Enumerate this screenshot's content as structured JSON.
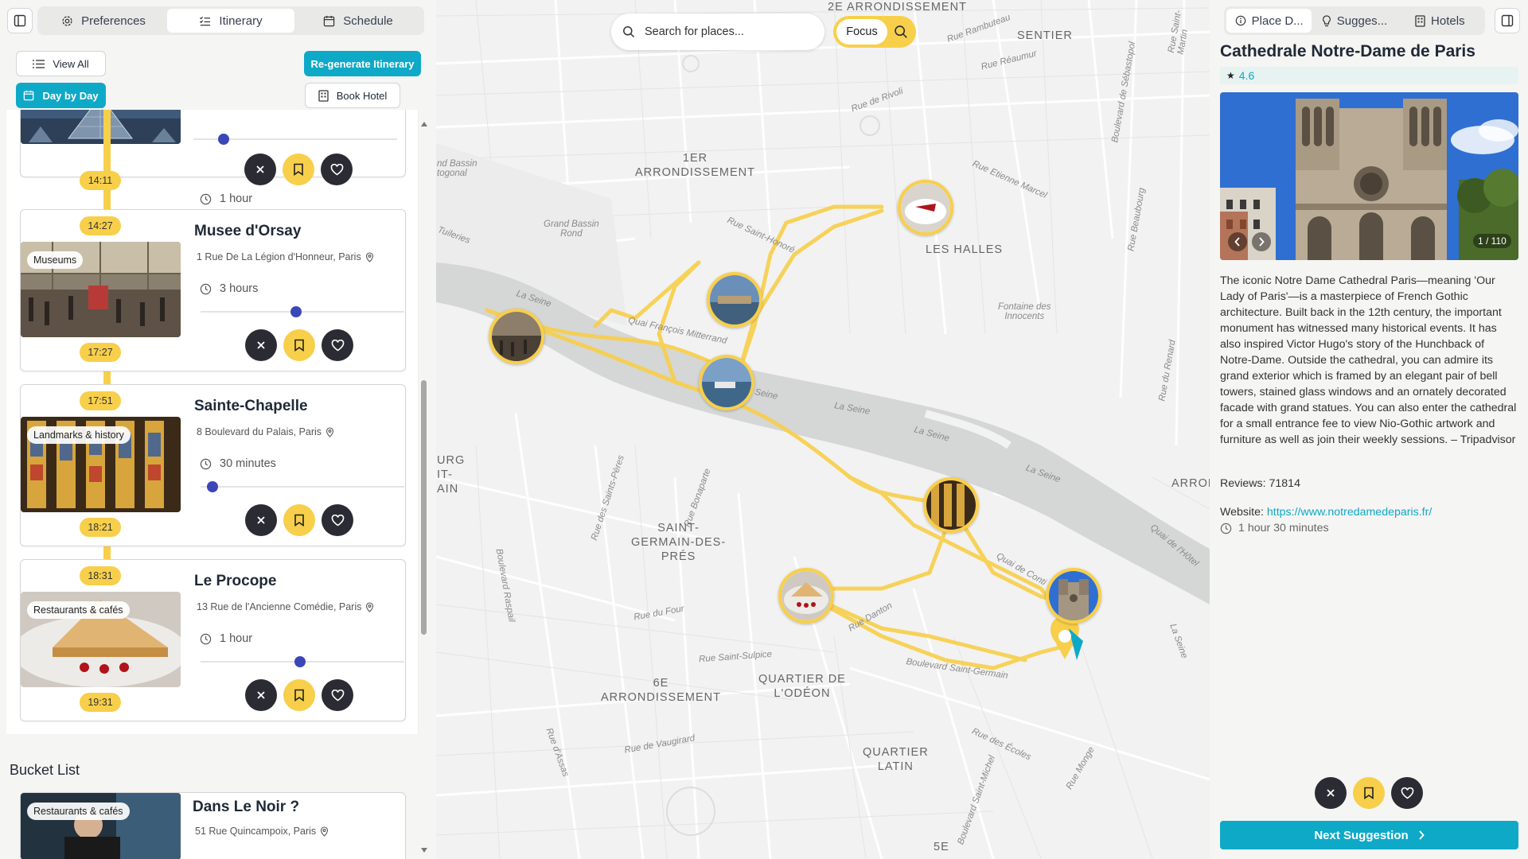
{
  "left": {
    "tabs": [
      {
        "label": "Preferences",
        "icon": "gear-icon"
      },
      {
        "label": "Itinerary",
        "icon": "list-check-icon",
        "active": true
      },
      {
        "label": "Schedule",
        "icon": "calendar-icon"
      }
    ],
    "view_all": "View All",
    "day_by_day": "Day by Day",
    "regenerate": "Re-generate Itinerary",
    "book_hotel": "Book Hotel",
    "top_card": {
      "duration": "1 hour",
      "slider": 0.15,
      "time_end": "14:11"
    },
    "items": [
      {
        "title": "Musee d'Orsay",
        "address": "1 Rue De La Légion d'Honneur, Paris",
        "category": "Museums",
        "duration": "3 hours",
        "slider": 0.47,
        "time_start": "14:27",
        "time_end": "17:27"
      },
      {
        "title": "Sainte-Chapelle",
        "address": "8 Boulevard du Palais, Paris",
        "category": "Landmarks & history",
        "duration": "30 minutes",
        "slider": 0.06,
        "time_start": "17:51",
        "time_end": "18:21"
      },
      {
        "title": "Le Procope",
        "address": "13 Rue de l'Ancienne Comédie, Paris",
        "category": "Restaurants & cafés",
        "duration": "1 hour",
        "slider": 0.49,
        "time_start": "18:31",
        "time_end": "19:31"
      }
    ],
    "bucket_title": "Bucket List",
    "bucket_items": [
      {
        "title": "Dans Le Noir ?",
        "address": "51 Rue Quincampoix, Paris",
        "category": "Restaurants & cafés"
      }
    ]
  },
  "map": {
    "search_placeholder": "Search for places...",
    "focus_label": "Focus",
    "labels": {
      "a1": "1ER\nARRONDISSEMENT",
      "a2": "2E ARRONDISSEMENT",
      "sentier": "SENTIER",
      "halles": "LES HALLES",
      "saint_germain": "SAINT-\nGERMAIN-DES-\nPRÉS",
      "odeon": "QUARTIER DE\nL'ODÉON",
      "a6": "6E\nARRONDISSEMENT",
      "latin": "QUARTIER\nLATIN",
      "a5": "5E",
      "arron": "ARRON",
      "faubourg": "URG\nIT-\nAIN",
      "grand_bassin": "Grand Bassin\nRond",
      "bassin": "nd Bassin\ntogonal",
      "fontaine": "Fontaine des\nInnocents"
    },
    "streets": {
      "s1": "La Seine",
      "s2": "Quai François Mitterrand",
      "s3": "Rue Saint-Honoré",
      "s4": "Rue Etienne Marcel",
      "s5": "Rue Réaumur",
      "s6": "Boulevard Saint-Germain",
      "s7": "Rue du Four",
      "s8": "Rue Danton",
      "s9": "Rue Saint-Sulpice",
      "s10": "Rue de Vaugirard",
      "s11": "Boulevard Raspail",
      "s12": "Rue Bonaparte",
      "s13": "Rue des Saints-Pères",
      "s14": "Boulevard de Sébastopol",
      "s15": "Rue Beaubourg",
      "s16": "Rue du Renard",
      "s17": "Rue des Écoles",
      "s18": "Rue Monge",
      "s19": "Rue d'Assas",
      "s20": "Quai de l'Hôtel",
      "s21": "Rue Rambuteau",
      "s22": "Boulevard Saint-Michel",
      "s23": "Rue Saint-Martin",
      "s24": "La Seine",
      "s25": "Quai de Conti",
      "s26": "Rue de Rivoli",
      "s27": "La Seine",
      "s28": "La Seine",
      "s29": "La Seine",
      "s30": "Tuileries",
      "s31": "Seine"
    }
  },
  "right": {
    "tabs": [
      {
        "label": "Place D...",
        "icon": "info-icon",
        "active": true
      },
      {
        "label": "Sugges...",
        "icon": "lightbulb-icon"
      },
      {
        "label": "Hotels",
        "icon": "building-icon"
      }
    ],
    "title": "Cathedrale Notre-Dame de Paris",
    "rating": "4.6",
    "photo_counter": "1 / 110",
    "description": "The iconic Notre Dame Cathedral Paris—meaning 'Our Lady of Paris'—is a masterpiece of French Gothic architecture. Built back in the 12th century, the important monument has witnessed many historical events. It has also inspired Victor Hugo's story of the Hunchback of Notre-Dame. Outside the cathedral, you can admire its grand exterior which is framed by an elegant pair of bell towers, stained glass windows and an ornately decorated facade with grand statues. You can also enter the cathedral for a small entrance fee to view Nio-Gothic artwork and furniture as well as join their weekly sessions. – Tripadvisor",
    "reviews_label": "Reviews:",
    "reviews": "71814",
    "website_label": "Website:",
    "website": "https://www.notredamedeparis.fr/",
    "duration": "1 hour 30 minutes",
    "next": "Next Suggestion"
  },
  "colors": {
    "accent": "#0fa9c8",
    "route": "#f8cf4a",
    "dark": "#2b2b33"
  }
}
